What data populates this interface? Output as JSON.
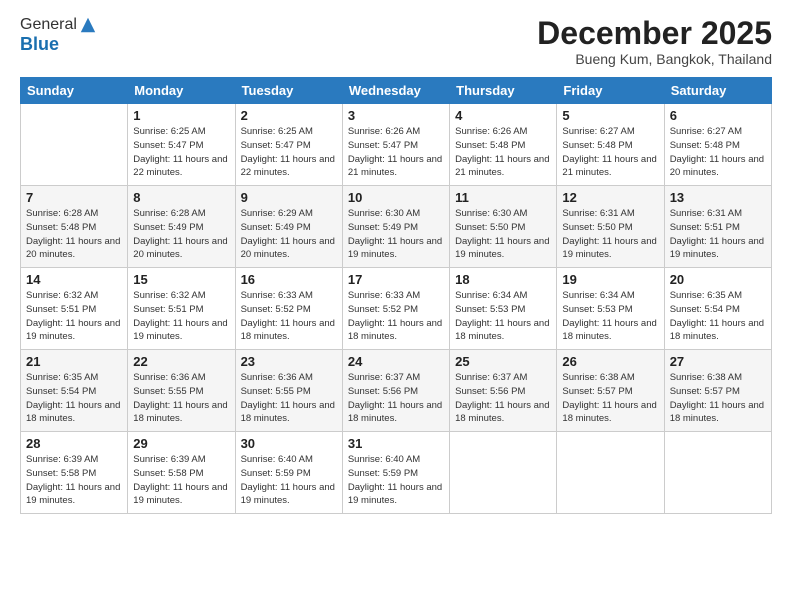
{
  "logo": {
    "general": "General",
    "blue": "Blue"
  },
  "header": {
    "month": "December 2025",
    "location": "Bueng Kum, Bangkok, Thailand"
  },
  "days_of_week": [
    "Sunday",
    "Monday",
    "Tuesday",
    "Wednesday",
    "Thursday",
    "Friday",
    "Saturday"
  ],
  "weeks": [
    [
      {
        "num": "",
        "sunrise": "",
        "sunset": "",
        "daylight": ""
      },
      {
        "num": "1",
        "sunrise": "Sunrise: 6:25 AM",
        "sunset": "Sunset: 5:47 PM",
        "daylight": "Daylight: 11 hours and 22 minutes."
      },
      {
        "num": "2",
        "sunrise": "Sunrise: 6:25 AM",
        "sunset": "Sunset: 5:47 PM",
        "daylight": "Daylight: 11 hours and 22 minutes."
      },
      {
        "num": "3",
        "sunrise": "Sunrise: 6:26 AM",
        "sunset": "Sunset: 5:47 PM",
        "daylight": "Daylight: 11 hours and 21 minutes."
      },
      {
        "num": "4",
        "sunrise": "Sunrise: 6:26 AM",
        "sunset": "Sunset: 5:48 PM",
        "daylight": "Daylight: 11 hours and 21 minutes."
      },
      {
        "num": "5",
        "sunrise": "Sunrise: 6:27 AM",
        "sunset": "Sunset: 5:48 PM",
        "daylight": "Daylight: 11 hours and 21 minutes."
      },
      {
        "num": "6",
        "sunrise": "Sunrise: 6:27 AM",
        "sunset": "Sunset: 5:48 PM",
        "daylight": "Daylight: 11 hours and 20 minutes."
      }
    ],
    [
      {
        "num": "7",
        "sunrise": "Sunrise: 6:28 AM",
        "sunset": "Sunset: 5:48 PM",
        "daylight": "Daylight: 11 hours and 20 minutes."
      },
      {
        "num": "8",
        "sunrise": "Sunrise: 6:28 AM",
        "sunset": "Sunset: 5:49 PM",
        "daylight": "Daylight: 11 hours and 20 minutes."
      },
      {
        "num": "9",
        "sunrise": "Sunrise: 6:29 AM",
        "sunset": "Sunset: 5:49 PM",
        "daylight": "Daylight: 11 hours and 20 minutes."
      },
      {
        "num": "10",
        "sunrise": "Sunrise: 6:30 AM",
        "sunset": "Sunset: 5:49 PM",
        "daylight": "Daylight: 11 hours and 19 minutes."
      },
      {
        "num": "11",
        "sunrise": "Sunrise: 6:30 AM",
        "sunset": "Sunset: 5:50 PM",
        "daylight": "Daylight: 11 hours and 19 minutes."
      },
      {
        "num": "12",
        "sunrise": "Sunrise: 6:31 AM",
        "sunset": "Sunset: 5:50 PM",
        "daylight": "Daylight: 11 hours and 19 minutes."
      },
      {
        "num": "13",
        "sunrise": "Sunrise: 6:31 AM",
        "sunset": "Sunset: 5:51 PM",
        "daylight": "Daylight: 11 hours and 19 minutes."
      }
    ],
    [
      {
        "num": "14",
        "sunrise": "Sunrise: 6:32 AM",
        "sunset": "Sunset: 5:51 PM",
        "daylight": "Daylight: 11 hours and 19 minutes."
      },
      {
        "num": "15",
        "sunrise": "Sunrise: 6:32 AM",
        "sunset": "Sunset: 5:51 PM",
        "daylight": "Daylight: 11 hours and 19 minutes."
      },
      {
        "num": "16",
        "sunrise": "Sunrise: 6:33 AM",
        "sunset": "Sunset: 5:52 PM",
        "daylight": "Daylight: 11 hours and 18 minutes."
      },
      {
        "num": "17",
        "sunrise": "Sunrise: 6:33 AM",
        "sunset": "Sunset: 5:52 PM",
        "daylight": "Daylight: 11 hours and 18 minutes."
      },
      {
        "num": "18",
        "sunrise": "Sunrise: 6:34 AM",
        "sunset": "Sunset: 5:53 PM",
        "daylight": "Daylight: 11 hours and 18 minutes."
      },
      {
        "num": "19",
        "sunrise": "Sunrise: 6:34 AM",
        "sunset": "Sunset: 5:53 PM",
        "daylight": "Daylight: 11 hours and 18 minutes."
      },
      {
        "num": "20",
        "sunrise": "Sunrise: 6:35 AM",
        "sunset": "Sunset: 5:54 PM",
        "daylight": "Daylight: 11 hours and 18 minutes."
      }
    ],
    [
      {
        "num": "21",
        "sunrise": "Sunrise: 6:35 AM",
        "sunset": "Sunset: 5:54 PM",
        "daylight": "Daylight: 11 hours and 18 minutes."
      },
      {
        "num": "22",
        "sunrise": "Sunrise: 6:36 AM",
        "sunset": "Sunset: 5:55 PM",
        "daylight": "Daylight: 11 hours and 18 minutes."
      },
      {
        "num": "23",
        "sunrise": "Sunrise: 6:36 AM",
        "sunset": "Sunset: 5:55 PM",
        "daylight": "Daylight: 11 hours and 18 minutes."
      },
      {
        "num": "24",
        "sunrise": "Sunrise: 6:37 AM",
        "sunset": "Sunset: 5:56 PM",
        "daylight": "Daylight: 11 hours and 18 minutes."
      },
      {
        "num": "25",
        "sunrise": "Sunrise: 6:37 AM",
        "sunset": "Sunset: 5:56 PM",
        "daylight": "Daylight: 11 hours and 18 minutes."
      },
      {
        "num": "26",
        "sunrise": "Sunrise: 6:38 AM",
        "sunset": "Sunset: 5:57 PM",
        "daylight": "Daylight: 11 hours and 18 minutes."
      },
      {
        "num": "27",
        "sunrise": "Sunrise: 6:38 AM",
        "sunset": "Sunset: 5:57 PM",
        "daylight": "Daylight: 11 hours and 18 minutes."
      }
    ],
    [
      {
        "num": "28",
        "sunrise": "Sunrise: 6:39 AM",
        "sunset": "Sunset: 5:58 PM",
        "daylight": "Daylight: 11 hours and 19 minutes."
      },
      {
        "num": "29",
        "sunrise": "Sunrise: 6:39 AM",
        "sunset": "Sunset: 5:58 PM",
        "daylight": "Daylight: 11 hours and 19 minutes."
      },
      {
        "num": "30",
        "sunrise": "Sunrise: 6:40 AM",
        "sunset": "Sunset: 5:59 PM",
        "daylight": "Daylight: 11 hours and 19 minutes."
      },
      {
        "num": "31",
        "sunrise": "Sunrise: 6:40 AM",
        "sunset": "Sunset: 5:59 PM",
        "daylight": "Daylight: 11 hours and 19 minutes."
      },
      {
        "num": "",
        "sunrise": "",
        "sunset": "",
        "daylight": ""
      },
      {
        "num": "",
        "sunrise": "",
        "sunset": "",
        "daylight": ""
      },
      {
        "num": "",
        "sunrise": "",
        "sunset": "",
        "daylight": ""
      }
    ]
  ]
}
